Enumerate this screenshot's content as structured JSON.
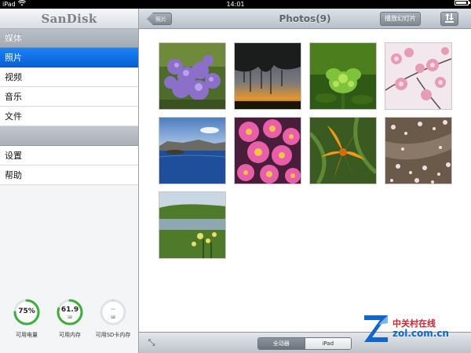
{
  "status_bar": {
    "device": "iPad",
    "time": "14:01",
    "battery_level": 0.9
  },
  "sidebar": {
    "brand": "SanDisk",
    "section_media": "媒体",
    "media_items": [
      {
        "label": "照片",
        "active": true
      },
      {
        "label": "视频",
        "active": false
      },
      {
        "label": "音乐",
        "active": false
      },
      {
        "label": "文件",
        "active": false
      }
    ],
    "other_items": [
      {
        "label": "设置"
      },
      {
        "label": "帮助"
      }
    ],
    "gauges": [
      {
        "value": "75%",
        "unit": "",
        "label": "可用电量",
        "fraction": 0.75,
        "color": "#3cae3a"
      },
      {
        "value": "61.9",
        "unit": "GB",
        "label": "可用内存",
        "fraction": 0.8,
        "color": "#3cae3a"
      },
      {
        "value": "--",
        "unit": "GB",
        "label": "可用SD卡内存",
        "fraction": 0,
        "color": "#cfd3d8"
      }
    ]
  },
  "header": {
    "back_label": "照片",
    "title": "Photos(9)",
    "slideshow_label": "播放幻灯片",
    "sort_icon": "sort-arrows-icon"
  },
  "photos": [
    {
      "subject": "lilac-flowers"
    },
    {
      "subject": "tree-sunset"
    },
    {
      "subject": "green-plant"
    },
    {
      "subject": "cherry-blossom"
    },
    {
      "subject": "crater-lake"
    },
    {
      "subject": "pink-daisies"
    },
    {
      "subject": "orange-lily"
    },
    {
      "subject": "petals-path"
    },
    {
      "subject": "meadow-pond"
    }
  ],
  "footer": {
    "segments": [
      {
        "label": "全动器",
        "selected": true
      },
      {
        "label": "iPad",
        "selected": false
      }
    ]
  },
  "watermark": {
    "cn": "中关村在线",
    "url": "zol.com.cn"
  }
}
